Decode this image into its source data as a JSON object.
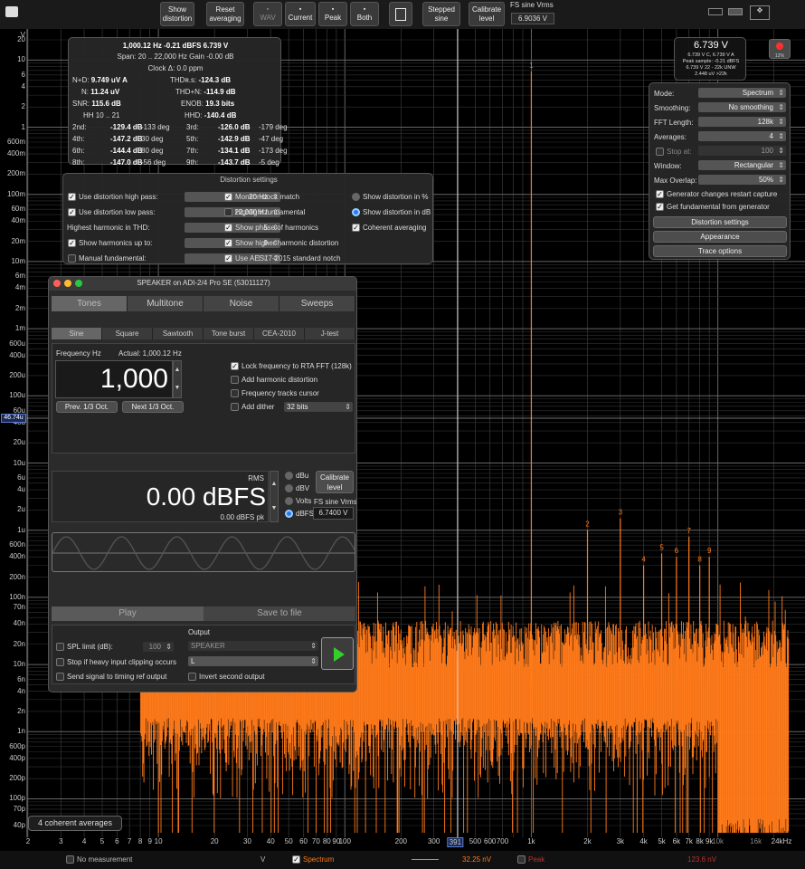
{
  "toolbar": {
    "show_distortion": "Show\ndistortion",
    "reset_averaging": "Reset\naveraging",
    "wav": "WAV",
    "current": "Current",
    "peak": "Peak",
    "both": "Both",
    "stepped_sine": "Stepped\nsine",
    "calibrate_level": "Calibrate\nlevel",
    "fs_sine_label": "FS sine Vrms",
    "fs_sine_value": "6.9036 V"
  },
  "y_axis": {
    "ticks": [
      "V",
      "20",
      "10",
      "6",
      "4",
      "2",
      "1",
      "600m",
      "400m",
      "200m",
      "100m",
      "60m",
      "40m",
      "20m",
      "10m",
      "6m",
      "4m",
      "2m",
      "1m",
      "600u",
      "400u",
      "200u",
      "100u",
      "60u",
      "40u",
      "20u",
      "10u",
      "6u",
      "4u",
      "2u",
      "1u",
      "600n",
      "400n",
      "200n",
      "100n",
      "70n",
      "40n",
      "20n",
      "10n",
      "6n",
      "4n",
      "2n",
      "1n",
      "600p",
      "400p",
      "200p",
      "100p",
      "70p",
      "40p"
    ],
    "cursor_value": "46.74u"
  },
  "x_axis": {
    "ticks": [
      "2",
      "3",
      "4",
      "5",
      "6",
      "7",
      "8",
      "9",
      "10",
      "20",
      "30",
      "40",
      "50",
      "60",
      "70",
      "80",
      "90",
      "100",
      "200",
      "300",
      "391",
      "500",
      "600",
      "700",
      "1k",
      "2k",
      "3k",
      "4k",
      "5k",
      "6k",
      "7k",
      "8k",
      "9k",
      "10k",
      "16k",
      "24kHz"
    ]
  },
  "chart_data": {
    "type": "line",
    "title": "",
    "xlabel": "",
    "ylabel": "V",
    "x_scale": "log",
    "y_scale": "log",
    "xlim": [
      2,
      24000
    ],
    "ylim": [
      4e-11,
      20
    ],
    "harmonics": [
      {
        "label": "1",
        "freq": 1000,
        "level": 6.739
      },
      {
        "label": "2",
        "freq": 2000,
        "level": 1e-06
      },
      {
        "label": "3",
        "freq": 3000,
        "level": 1.5e-06
      },
      {
        "label": "4",
        "freq": 4000,
        "level": 3e-07
      },
      {
        "label": "5",
        "freq": 5000,
        "level": 4.5e-07
      },
      {
        "label": "6",
        "freq": 6000,
        "level": 4e-07
      },
      {
        "label": "7",
        "freq": 7000,
        "level": 8e-07
      },
      {
        "label": "8",
        "freq": 8000,
        "level": 3e-07
      },
      {
        "label": "9",
        "freq": 9000,
        "level": 4e-07
      }
    ],
    "noise_floor_band": [
      1e-09,
      3e-08
    ],
    "color": "#ff7a1a"
  },
  "stats": {
    "line1": "1,000.12 Hz  -0.21 dBFS  6.739 V",
    "line2": "Span: 20 .. 22,000 Hz   Gain -0.00 dB",
    "line3": "Clock Δ: 0.0 ppm",
    "nd_l": "N+D:",
    "nd_v": "9.749 uV A",
    "thd_l": "THDʀ.s:",
    "thd_v": "-124.3 dB",
    "n_l": "N:",
    "n_v": "11.24 uV",
    "thdn_l": "THD+N:",
    "thdn_v": "-114.9 dB",
    "snr_l": "SNR:",
    "snr_v": "115.6 dB",
    "enob_l": "ENOB:",
    "enob_v": "19.3 bits",
    "hh_l": "HH 10 .. 21",
    "hhd_l": "HHD:",
    "hhd_v": "-140.4 dB",
    "h": [
      [
        "2nd:",
        "-129.4 dB",
        "-133 deg",
        "3rd:",
        "-126.0 dB",
        "-179 deg"
      ],
      [
        "4th:",
        "-147.2 dB",
        "30 deg",
        "5th:",
        "-142.9 dB",
        "-47 deg"
      ],
      [
        "6th:",
        "-144.4 dB",
        "80 deg",
        "7th:",
        "-134.1 dB",
        "-173 deg"
      ],
      [
        "8th:",
        "-147.0 dB",
        "-56 deg",
        "9th:",
        "-143.7 dB",
        "-5 deg"
      ]
    ]
  },
  "dist": {
    "title": "Distortion settings",
    "hp": "Use distortion high pass:",
    "hp_v": "20 Hz",
    "lp": "Use distortion low pass:",
    "lp_v": "22,000 Hz",
    "hh": "Highest harmonic in THD:",
    "hh_v": "5",
    "shu": "Show harmonics up to:",
    "shu_v": "9",
    "mf": "Manual fundamental:",
    "mf_v": "1 V",
    "mcm": "Monitor clock match",
    "hf": "Highlight fundamental",
    "sph": "Show phase of harmonics",
    "shd": "Show higher harmonic distortion",
    "aes": "Use AES17-2015 standard notch",
    "pct": "Show distortion in %",
    "db": "Show distortion in dB",
    "coh": "Coherent averaging"
  },
  "level_box": {
    "big": "6.739 V",
    "l1": "6.739 V C, 6.739 V A",
    "l2": "Peak sample: -0.21 dBFS",
    "l3": "6.739 V 22 - 22k UNW",
    "l4": "2.448 uV >22k",
    "rec": "12%"
  },
  "right": {
    "mode_l": "Mode:",
    "mode_v": "Spectrum",
    "sm_l": "Smoothing:",
    "sm_v": "No smoothing",
    "fft_l": "FFT Length:",
    "fft_v": "128k",
    "avg_l": "Averages:",
    "avg_v": "4",
    "stop_l": "Stop at:",
    "stop_v": "100",
    "win_l": "Window:",
    "win_v": "Rectangular",
    "ov_l": "Max Overlap:",
    "ov_v": "50%",
    "gcr": "Generator changes restart capture",
    "gff": "Get fundamental from generator",
    "b1": "Distortion settings",
    "b2": "Appearance",
    "b3": "Trace options"
  },
  "gen": {
    "title": "SPEAKER on ADI-2/4 Pro SE (53011127)",
    "tabs": [
      "Tones",
      "Multitone",
      "Noise",
      "Sweeps"
    ],
    "subtabs": [
      "Sine",
      "Square",
      "Sawtooth",
      "Tone burst",
      "CEA-2010",
      "J-test"
    ],
    "freq_l": "Frequency Hz",
    "actual": "Actual: 1,000.12 Hz",
    "freq_v": "1,000",
    "prev": "Prev. 1/3 Oct.",
    "next": "Next 1/3 Oct.",
    "lock": "Lock frequency to RTA FFT (128k)",
    "ahd": "Add harmonic distortion",
    "ftc": "Frequency tracks cursor",
    "dither": "Add dither",
    "dither_v": "32 bits",
    "rms": "RMS",
    "level": "0.00 dBFS",
    "pk": "0.00 dBFS pk",
    "u1": "dBu",
    "u2": "dBV",
    "u3": "Volts",
    "u4": "dBFS",
    "cal": "Calibrate\nlevel",
    "fs": "FS sine Vrms",
    "fs_v": "6.7400 V",
    "play": "Play",
    "save": "Save to file",
    "spl": "SPL limit (dB):",
    "spl_v": "100",
    "stop": "Stop if heavy input clipping occurs",
    "send": "Send signal to timing ref output",
    "out_l": "Output",
    "out_v": "SPEAKER",
    "ch_v": "L",
    "inv": "Invert second output"
  },
  "avg_badge": "4 coherent averages",
  "bottom": {
    "nm": "No measurement",
    "v": "V",
    "spec": "Spectrum",
    "spec_v": "32.25 nV",
    "peak": "Peak",
    "peak_v": "123.6 nV"
  }
}
